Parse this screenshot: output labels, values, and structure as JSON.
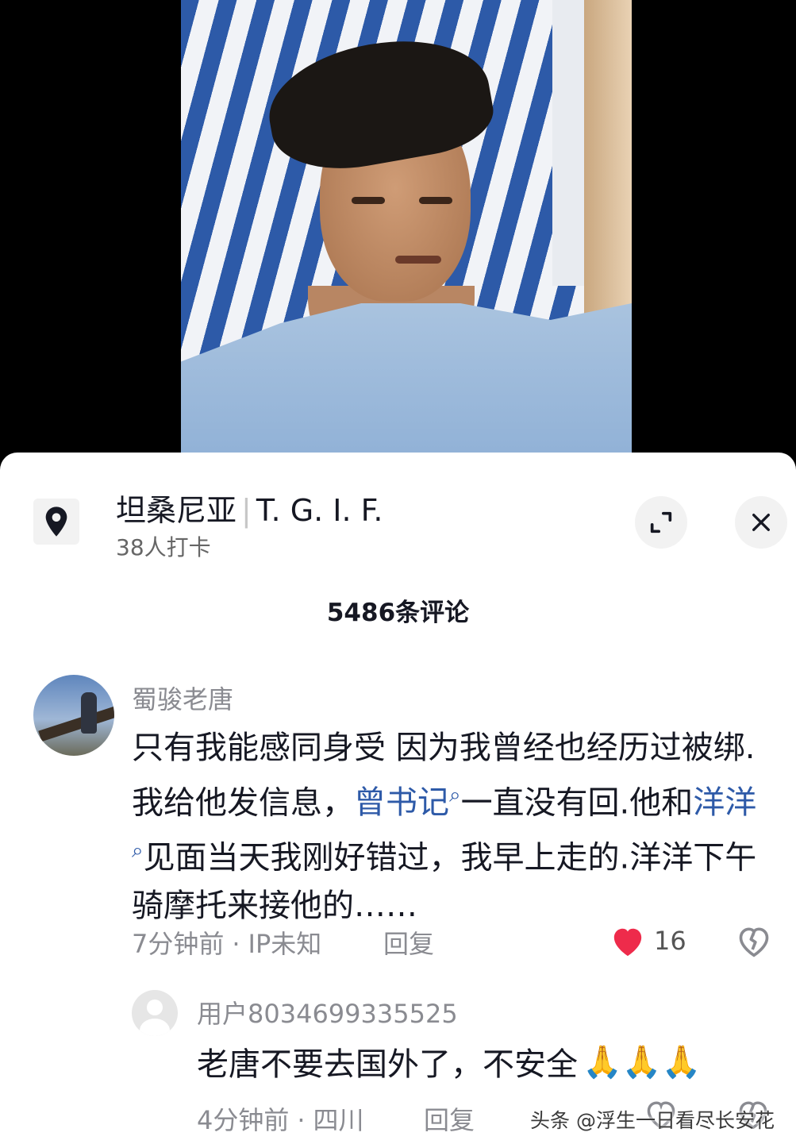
{
  "location": {
    "title": "坦桑尼亚",
    "tag": "T. G. I. F.",
    "checkins": "38人打卡"
  },
  "comments_count": "5486条评论",
  "comment_1": {
    "user": "蜀骏老唐",
    "text_a": "只有我能感同身受 因为我曾经也经历过被绑.我给他发信息，",
    "link_1": "曾书记",
    "text_b": "一直没有回.他和",
    "link_2": "洋洋",
    "text_c": "见面当天我刚好错过，我早上走的.洋洋下午骑摩托来接他的……",
    "time": "7分钟前",
    "ip": "IP未知",
    "reply": "回复",
    "likes": "16"
  },
  "comment_2": {
    "user": "用户8034699335525",
    "text": "老唐不要去国外了，不安全",
    "emoji": "🙏🙏🙏",
    "time": "4分钟前",
    "ip": "四川",
    "reply": "回复"
  },
  "watermark": "头条 @浮生一日看尽长安花",
  "colors": {
    "like_red": "#ee2b4b",
    "link_blue": "#2e5aa8",
    "text_dark": "#161823",
    "text_gray": "#8a8b91"
  },
  "icons": [
    "location-pin-icon",
    "expand-icon",
    "close-icon",
    "heart-icon",
    "broken-heart-icon",
    "search-mini-icon",
    "avatar-placeholder-icon"
  ]
}
